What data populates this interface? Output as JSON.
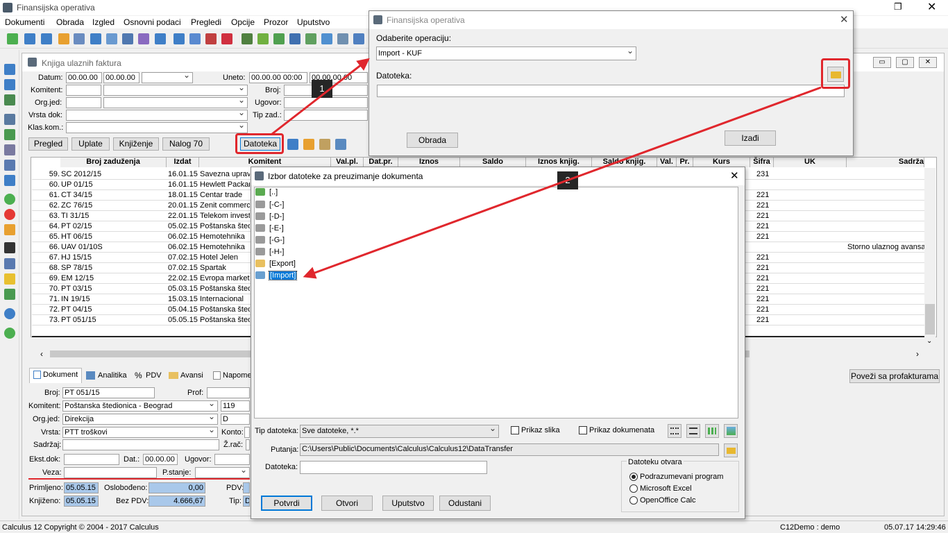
{
  "app": {
    "title": "Finansijska operativa",
    "menu": [
      "Dokumenti",
      "Obrada",
      "Izgled",
      "Osnovni podaci",
      "Pregledi",
      "Opcije",
      "Prozor",
      "Uputstvo"
    ]
  },
  "kuf": {
    "title": "Knjiga ulaznih faktura",
    "filters": {
      "datum_label": "Datum:",
      "datum_from": "00.00.00",
      "datum_to": "00.00.00",
      "uneto_label": "Uneto:",
      "uneto_from": "00.00.00 00:00",
      "uneto_to": "00.00.00.00",
      "komitent_label": "Komitent:",
      "broj_label": "Broj:",
      "orgjed_label": "Org.jed:",
      "ugovor_label": "Ugovor:",
      "vrstadok_label": "Vrsta dok:",
      "tipzad_label": "Tip zad.:",
      "klaskom_label": "Klas.kom.:"
    },
    "buttons": {
      "pregled": "Pregled",
      "uplate": "Uplate",
      "knjizenje": "Knjiženje",
      "nalog": "Nalog 70",
      "datoteka": "Datoteka"
    },
    "columns": [
      "Broj zaduženja",
      "Izdat",
      "Komitent",
      "Val.pl.",
      "Dat.pr.",
      "Iznos",
      "Saldo",
      "Iznos knjig.",
      "Saldo knjig.",
      "Val.",
      "Pr.",
      "Kurs",
      "Šifra",
      "UK",
      "Sadrža"
    ],
    "rows": [
      {
        "n": "59.",
        "broj": "SC 2012/15",
        "izdat": "16.01.15",
        "komitent": "Savezna uprav",
        "sifra": "231",
        "sadrzaj": ""
      },
      {
        "n": "60.",
        "broj": "UP 01/15",
        "izdat": "16.01.15",
        "komitent": "Hewlett Packar",
        "sifra": "",
        "sadrzaj": ""
      },
      {
        "n": "61.",
        "broj": "CT 34/15",
        "izdat": "18.01.15",
        "komitent": "Centar trade",
        "sifra": "221",
        "sadrzaj": ""
      },
      {
        "n": "62.",
        "broj": "ZC 76/15",
        "izdat": "20.01.15",
        "komitent": "Zenit commerc",
        "sifra": "221",
        "sadrzaj": ""
      },
      {
        "n": "63.",
        "broj": "TI 31/15",
        "izdat": "22.01.15",
        "komitent": "Telekom invest",
        "sifra": "221",
        "sadrzaj": ""
      },
      {
        "n": "64.",
        "broj": "PT 02/15",
        "izdat": "05.02.15",
        "komitent": "Poštanska šted",
        "sifra": "221",
        "sadrzaj": ""
      },
      {
        "n": "65.",
        "broj": "HT 06/15",
        "izdat": "06.02.15",
        "komitent": "Hemotehnika",
        "sifra": "221",
        "sadrzaj": ""
      },
      {
        "n": "66.",
        "broj": "UAV 01/10S",
        "izdat": "06.02.15",
        "komitent": "Hemotehnika",
        "sifra": "",
        "sadrzaj": "Storno ulaznog avansa"
      },
      {
        "n": "67.",
        "broj": "HJ 15/15",
        "izdat": "07.02.15",
        "komitent": "Hotel Jelen",
        "sifra": "221",
        "sadrzaj": ""
      },
      {
        "n": "68.",
        "broj": "SP 78/15",
        "izdat": "07.02.15",
        "komitent": "Spartak",
        "sifra": "221",
        "sadrzaj": ""
      },
      {
        "n": "69.",
        "broj": "EM 12/15",
        "izdat": "22.02.15",
        "komitent": "Evropa marketi",
        "sifra": "221",
        "sadrzaj": ""
      },
      {
        "n": "70.",
        "broj": "PT 03/15",
        "izdat": "05.03.15",
        "komitent": "Poštanska šted",
        "sifra": "221",
        "sadrzaj": ""
      },
      {
        "n": "71.",
        "broj": "IN 19/15",
        "izdat": "15.03.15",
        "komitent": "Internacional",
        "sifra": "221",
        "sadrzaj": ""
      },
      {
        "n": "72.",
        "broj": "PT 04/15",
        "izdat": "05.04.15",
        "komitent": "Poštanska šted",
        "sifra": "221",
        "sadrzaj": ""
      },
      {
        "n": "73.",
        "broj": "PT 051/15",
        "izdat": "05.05.15",
        "komitent": "Poštanska šted",
        "sifra": "221",
        "sadrzaj": ""
      }
    ],
    "tabs": [
      "Dokument",
      "Analitika",
      "PDV",
      "Avansi",
      "Napome"
    ],
    "povezi": "Poveži sa profakturama",
    "detail": {
      "broj_label": "Broj:",
      "broj": "PT 051/15",
      "prof_label": "Prof:",
      "komitent_label": "Komitent:",
      "komitent": "Poštanska štedionica - Beograd",
      "komitent_code": "119",
      "orgjed_label": "Org.jed:",
      "orgjed": "Direkcija",
      "orgjed_code": "D",
      "vrsta_label": "Vrsta:",
      "vrsta": "PTT troškovi",
      "konto_label": "Konto:",
      "sadrzaj_label": "Sadržaj:",
      "zrac_label": "Ž.rač:",
      "ekstdok_label": "Ekst.dok:",
      "dat_label": "Dat.:",
      "dat": "00.00.00",
      "ugovor_label": "Ugovor:",
      "veza_label": "Veza:",
      "pstanje_label": "P.stanje:",
      "primljeno_label": "Primljeno:",
      "primljeno": "05.05.15",
      "oslobodjeno_label": "Oslobođeno:",
      "oslobodjeno": "0,00",
      "pdv_label": "PDV:",
      "knjizeno_label": "Knjiženo:",
      "knjizeno": "05.05.15",
      "bezpdv_label": "Bez PDV:",
      "bezpdv": "4.666,67",
      "tip_label": "Tip:",
      "tip": "D"
    }
  },
  "dialog1": {
    "title": "Finansijska operativa",
    "op_label": "Odaberite operaciju:",
    "op_value": "Import - KUF",
    "file_label": "Datoteka:",
    "obrada": "Obrada",
    "izadji": "Izađi"
  },
  "dialog2": {
    "title": "Izbor datoteke za preuzimanje dokumenta",
    "entries": [
      "[..]",
      "[-C-]",
      "[-D-]",
      "[-E-]",
      "[-G-]",
      "[-H-]",
      "[Export]",
      "[Import]"
    ],
    "tip_label": "Tip datoteka:",
    "tip_value": "Sve datoteke, *.*",
    "prikaz_slika": "Prikaz slika",
    "prikaz_dokumenata": "Prikaz dokumenata",
    "putanja_label": "Putanja:",
    "putanja": "C:\\Users\\Public\\Documents\\Calculus\\Calculus12\\DataTransfer",
    "datoteka_label": "Datoteka:",
    "otvara_label": "Datoteku otvara",
    "options": [
      "Podrazumevani program",
      "Microsoft Excel",
      "OpenOffice Calc"
    ],
    "potvrdi": "Potvrdi",
    "otvori": "Otvori",
    "uputstvo": "Uputstvo",
    "odustani": "Odustani"
  },
  "callouts": [
    "1",
    "2"
  ],
  "status": {
    "left": "Calculus 12  Copyright © 2004 - 2017  Calculus",
    "user": "C12Demo : demo",
    "time": "05.07.17 14:29:46"
  },
  "colors": {
    "accent": "#e0272d",
    "selection": "#0078d7",
    "field_blue": "#a9c8ea"
  }
}
